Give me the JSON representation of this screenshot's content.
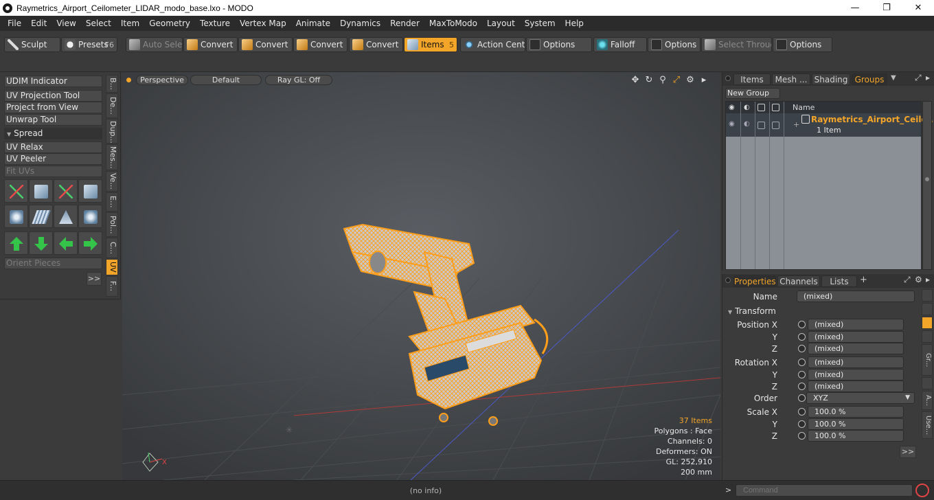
{
  "window": {
    "title": "Raymetrics_Airport_Ceilometer_LIDAR_modo_base.lxo - MODO",
    "min_glyph": "—",
    "max_glyph": "❐",
    "close_glyph": "✕"
  },
  "menu": [
    "File",
    "Edit",
    "View",
    "Select",
    "Item",
    "Geometry",
    "Texture",
    "Vertex Map",
    "Animate",
    "Dynamics",
    "Render",
    "MaxToModo",
    "Layout",
    "System",
    "Help"
  ],
  "toolbar": {
    "sculpt": "Sculpt",
    "presets": "Presets",
    "presets_key": "F6",
    "auto_select": "Auto Select",
    "convert1": "Convert",
    "convert2": "Convert",
    "convert3": "Convert",
    "convert4": "Convert",
    "items": "Items",
    "items_key": "5",
    "action_center": "Action Center",
    "options1": "Options",
    "falloff": "Falloff",
    "options2": "Options",
    "select_through": "Select Through",
    "options3": "Options"
  },
  "left_panel": {
    "udim": "UDIM Indicator",
    "uv_projection": "UV Projection Tool",
    "project_from_view": "Project from View",
    "unwrap": "Unwrap Tool",
    "spread": "Spread",
    "uv_relax": "UV Relax",
    "uv_peeler": "UV Peeler",
    "fit_uvs": "Fit UVs",
    "orient_pieces": "Orient Pieces",
    "expand": ">>",
    "vtabs": [
      "B...",
      "De...",
      "Dup...",
      "Mes...",
      "Ve...",
      "E...",
      "Pol...",
      "C...",
      "UV",
      "F..."
    ]
  },
  "viewport": {
    "perspective": "Perspective",
    "default": "Default",
    "raygl": "Ray GL: Off",
    "stats": {
      "items": "37 Items",
      "polygons": "Polygons : Face",
      "channels": "Channels: 0",
      "deformers": "Deformers: ON",
      "gl": "GL: 252,910",
      "size": "200 mm"
    },
    "axis_x": "X"
  },
  "groups_panel": {
    "tabs": [
      "Items",
      "Mesh ...",
      "Shading",
      "Groups"
    ],
    "new_group": "New Group",
    "col_name": "Name",
    "group_name": "Raymetrics_Airport_Ceilo...",
    "group_count": "1 Item"
  },
  "props_panel": {
    "tabs": [
      "Properties",
      "Channels",
      "Lists"
    ],
    "add_tab": "+",
    "name_label": "Name",
    "name_value": "(mixed)",
    "transform": "Transform",
    "position_x_label": "Position X",
    "rotation_x_label": "Rotation X",
    "scale_x_label": "Scale X",
    "y_label": "Y",
    "z_label": "Z",
    "order_label": "Order",
    "order_value": "XYZ",
    "mixed": "(mixed)",
    "scale_value": "100.0 %",
    "side_tabs": [
      "",
      "",
      "",
      "",
      "Gr...",
      "",
      "A...",
      "Use..."
    ],
    "expand": ">>"
  },
  "status": {
    "info": "(no info)",
    "command_placeholder": "Command",
    "prompt": ">"
  },
  "colors": {
    "accent": "#f3a529",
    "background": "#3b3b3b",
    "wire": "#ff9e1a"
  }
}
